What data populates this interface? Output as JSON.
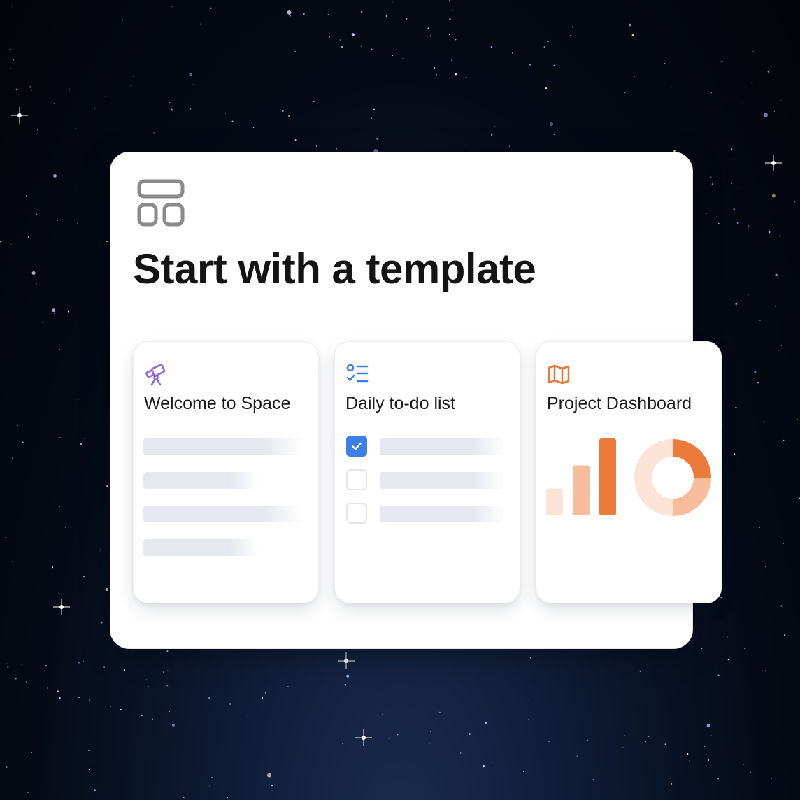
{
  "page": {
    "title": "Start with a template",
    "layout_icon": "layout-template-icon"
  },
  "templates": [
    {
      "title": "Welcome to Space",
      "icon": "telescope-icon",
      "icon_color": "#8b6be0"
    },
    {
      "title": "Daily to-do list",
      "icon": "checklist-icon",
      "icon_color": "#3d7ee8",
      "items": [
        {
          "checked": true
        },
        {
          "checked": false
        },
        {
          "checked": false
        }
      ]
    },
    {
      "title": "Project Dashboard",
      "icon": "map-icon",
      "icon_color": "#e8793a",
      "chart_data": {
        "type": "bar",
        "values": [
          0.35,
          0.65,
          1.0
        ],
        "colors": [
          "#fbe3d6",
          "#f6bc9c",
          "#ec7a3b"
        ],
        "donut": {
          "type": "pie",
          "values": [
            0.25,
            0.25,
            0.5
          ],
          "colors": [
            "#ec7a3b",
            "#f6bc9c",
            "#fbe3d6"
          ]
        }
      }
    }
  ],
  "colors": {
    "accent_blue": "#3d7ee8",
    "accent_orange": "#e8793a",
    "accent_purple": "#8b6be0",
    "placeholder": "#e6e8ed"
  }
}
